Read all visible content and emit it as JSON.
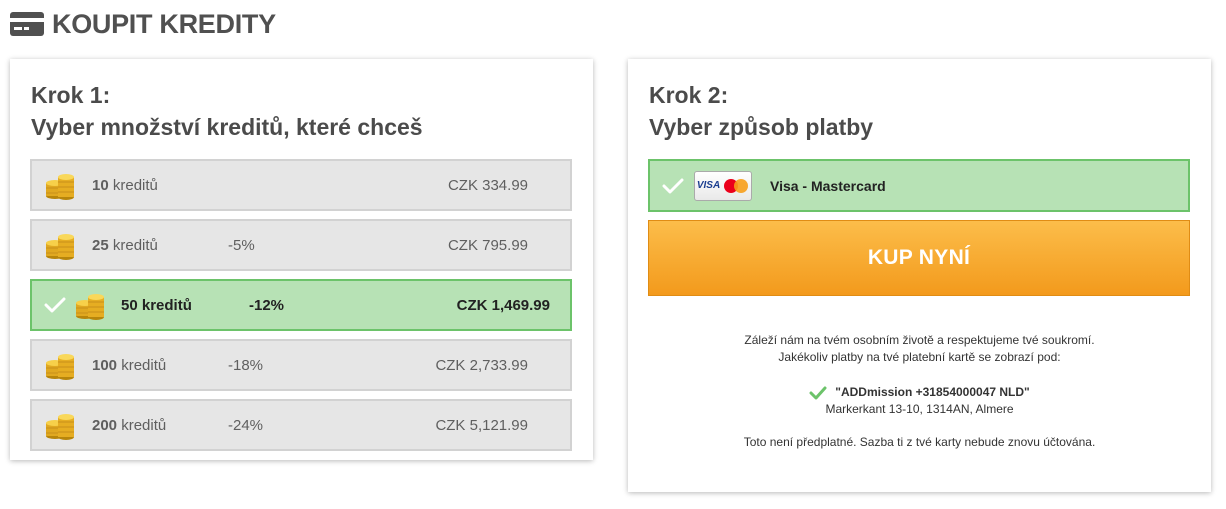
{
  "header": {
    "icon": "credit-card-icon",
    "title": "KOUPIT KREDITY"
  },
  "step1": {
    "line1": "Krok 1:",
    "line2": "Vyber množství kreditů, které chceš",
    "packages": [
      {
        "amount": "10",
        "unit": "kreditů",
        "discount": "",
        "price": "CZK 334.99",
        "selected": false
      },
      {
        "amount": "25",
        "unit": "kreditů",
        "discount": "-5%",
        "price": "CZK 795.99",
        "selected": false
      },
      {
        "amount": "50",
        "unit": "kreditů",
        "discount": "-12%",
        "price": "CZK 1,469.99",
        "selected": true
      },
      {
        "amount": "100",
        "unit": "kreditů",
        "discount": "-18%",
        "price": "CZK 2,733.99",
        "selected": false
      },
      {
        "amount": "200",
        "unit": "kreditů",
        "discount": "-24%",
        "price": "CZK 5,121.99",
        "selected": false
      }
    ]
  },
  "step2": {
    "line1": "Krok 2:",
    "line2": "Vyber způsob platby",
    "payment": {
      "logo": "VISA",
      "label": "Visa - Mastercard",
      "selected": true
    },
    "buy_label": "KUP NYNÍ",
    "privacy_line1": "Záleží nám na tvém osobním životě a respektujeme tvé soukromí.",
    "privacy_line2": "Jakékoliv platby na tvé platební kartě se zobrazí pod:",
    "merchant_name": "\"ADDmission +31854000047 NLD\"",
    "merchant_address": "Markerkant 13-10, 1314AN, Almere",
    "note": "Toto není předplatné. Sazba ti z tvé karty nebude znovu účtována."
  },
  "colors": {
    "selected_bg": "#b7e2b5",
    "selected_border": "#6cc36a",
    "button": "#f5a623",
    "check": "#6cc36a"
  }
}
